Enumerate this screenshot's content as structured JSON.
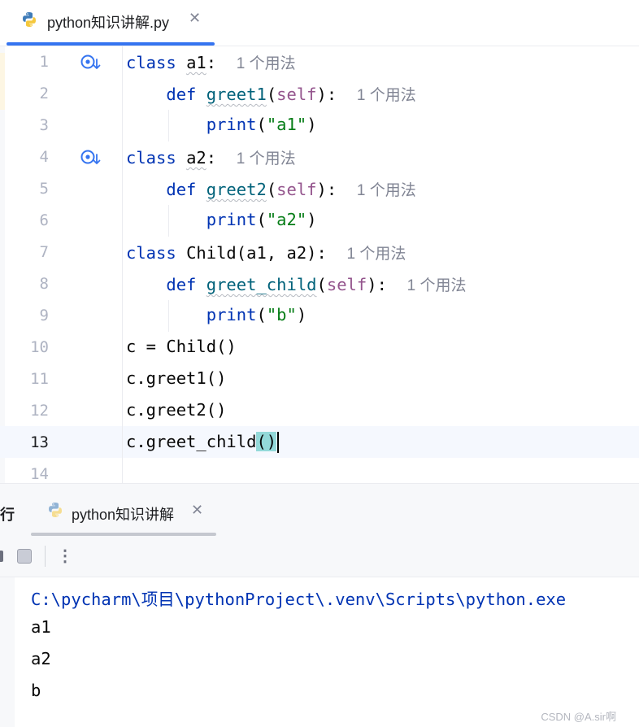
{
  "editor_tab": {
    "title": "python知识讲解.py",
    "close": "✕"
  },
  "usage_hint": "1 个用法",
  "code_lines": {
    "l1": {
      "num": "1",
      "kw": "class",
      "name": "a1",
      "colon": ":"
    },
    "l2": {
      "num": "2",
      "kw": "def",
      "name": "greet1",
      "open": "(",
      "self": "self",
      "close": "):"
    },
    "l3": {
      "num": "3",
      "fn": "print",
      "open": "(",
      "str": "\"a1\"",
      "close": ")"
    },
    "l4": {
      "num": "4",
      "kw": "class",
      "name": "a2",
      "colon": ":"
    },
    "l5": {
      "num": "5",
      "kw": "def",
      "name": "greet2",
      "open": "(",
      "self": "self",
      "close": "):"
    },
    "l6": {
      "num": "6",
      "fn": "print",
      "open": "(",
      "str": "\"a2\"",
      "close": ")"
    },
    "l7": {
      "num": "7",
      "kw": "class",
      "rest": "Child(a1, a2):"
    },
    "l8": {
      "num": "8",
      "kw": "def",
      "name": "greet_child",
      "open": "(",
      "self": "self",
      "close": "):"
    },
    "l9": {
      "num": "9",
      "fn": "print",
      "open": "(",
      "str": "\"b\"",
      "close": ")"
    },
    "l10": {
      "num": "10",
      "text": "c = Child()"
    },
    "l11": {
      "num": "11",
      "text": "c.greet1()"
    },
    "l12": {
      "num": "12",
      "text": "c.greet2()"
    },
    "l13": {
      "num": "13",
      "text": "c.greet_child",
      "paren": "()"
    },
    "l14": {
      "num": "14"
    }
  },
  "run_panel": {
    "label": "行",
    "tab_title": "python知识讲解",
    "close": "✕",
    "more": "⋮"
  },
  "console": [
    "C:\\pycharm\\项目\\pythonProject\\.venv\\Scripts\\python.exe",
    "a1",
    "a2",
    "b"
  ],
  "watermark": "CSDN @A.sir啊",
  "colors": {
    "keyword": "#0033b3",
    "function": "#00627a",
    "self": "#94558d",
    "string": "#067d17",
    "accent": "#3574f0"
  },
  "icons": {
    "file": "python-icon",
    "gutter": "implemented-down-icon",
    "stop": "stop-icon",
    "more": "more-vertical-icon"
  }
}
